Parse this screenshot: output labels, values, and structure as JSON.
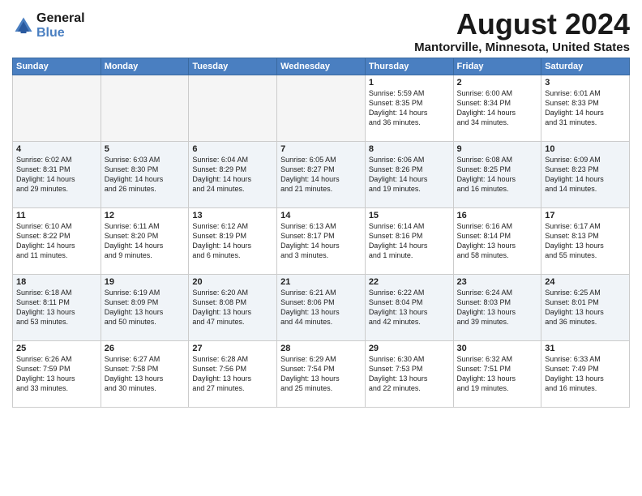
{
  "header": {
    "logo_line1": "General",
    "logo_line2": "Blue",
    "month": "August 2024",
    "location": "Mantorville, Minnesota, United States"
  },
  "weekdays": [
    "Sunday",
    "Monday",
    "Tuesday",
    "Wednesday",
    "Thursday",
    "Friday",
    "Saturday"
  ],
  "weeks": [
    [
      {
        "day": "",
        "info": ""
      },
      {
        "day": "",
        "info": ""
      },
      {
        "day": "",
        "info": ""
      },
      {
        "day": "",
        "info": ""
      },
      {
        "day": "1",
        "info": "Sunrise: 5:59 AM\nSunset: 8:35 PM\nDaylight: 14 hours\nand 36 minutes."
      },
      {
        "day": "2",
        "info": "Sunrise: 6:00 AM\nSunset: 8:34 PM\nDaylight: 14 hours\nand 34 minutes."
      },
      {
        "day": "3",
        "info": "Sunrise: 6:01 AM\nSunset: 8:33 PM\nDaylight: 14 hours\nand 31 minutes."
      }
    ],
    [
      {
        "day": "4",
        "info": "Sunrise: 6:02 AM\nSunset: 8:31 PM\nDaylight: 14 hours\nand 29 minutes."
      },
      {
        "day": "5",
        "info": "Sunrise: 6:03 AM\nSunset: 8:30 PM\nDaylight: 14 hours\nand 26 minutes."
      },
      {
        "day": "6",
        "info": "Sunrise: 6:04 AM\nSunset: 8:29 PM\nDaylight: 14 hours\nand 24 minutes."
      },
      {
        "day": "7",
        "info": "Sunrise: 6:05 AM\nSunset: 8:27 PM\nDaylight: 14 hours\nand 21 minutes."
      },
      {
        "day": "8",
        "info": "Sunrise: 6:06 AM\nSunset: 8:26 PM\nDaylight: 14 hours\nand 19 minutes."
      },
      {
        "day": "9",
        "info": "Sunrise: 6:08 AM\nSunset: 8:25 PM\nDaylight: 14 hours\nand 16 minutes."
      },
      {
        "day": "10",
        "info": "Sunrise: 6:09 AM\nSunset: 8:23 PM\nDaylight: 14 hours\nand 14 minutes."
      }
    ],
    [
      {
        "day": "11",
        "info": "Sunrise: 6:10 AM\nSunset: 8:22 PM\nDaylight: 14 hours\nand 11 minutes."
      },
      {
        "day": "12",
        "info": "Sunrise: 6:11 AM\nSunset: 8:20 PM\nDaylight: 14 hours\nand 9 minutes."
      },
      {
        "day": "13",
        "info": "Sunrise: 6:12 AM\nSunset: 8:19 PM\nDaylight: 14 hours\nand 6 minutes."
      },
      {
        "day": "14",
        "info": "Sunrise: 6:13 AM\nSunset: 8:17 PM\nDaylight: 14 hours\nand 3 minutes."
      },
      {
        "day": "15",
        "info": "Sunrise: 6:14 AM\nSunset: 8:16 PM\nDaylight: 14 hours\nand 1 minute."
      },
      {
        "day": "16",
        "info": "Sunrise: 6:16 AM\nSunset: 8:14 PM\nDaylight: 13 hours\nand 58 minutes."
      },
      {
        "day": "17",
        "info": "Sunrise: 6:17 AM\nSunset: 8:13 PM\nDaylight: 13 hours\nand 55 minutes."
      }
    ],
    [
      {
        "day": "18",
        "info": "Sunrise: 6:18 AM\nSunset: 8:11 PM\nDaylight: 13 hours\nand 53 minutes."
      },
      {
        "day": "19",
        "info": "Sunrise: 6:19 AM\nSunset: 8:09 PM\nDaylight: 13 hours\nand 50 minutes."
      },
      {
        "day": "20",
        "info": "Sunrise: 6:20 AM\nSunset: 8:08 PM\nDaylight: 13 hours\nand 47 minutes."
      },
      {
        "day": "21",
        "info": "Sunrise: 6:21 AM\nSunset: 8:06 PM\nDaylight: 13 hours\nand 44 minutes."
      },
      {
        "day": "22",
        "info": "Sunrise: 6:22 AM\nSunset: 8:04 PM\nDaylight: 13 hours\nand 42 minutes."
      },
      {
        "day": "23",
        "info": "Sunrise: 6:24 AM\nSunset: 8:03 PM\nDaylight: 13 hours\nand 39 minutes."
      },
      {
        "day": "24",
        "info": "Sunrise: 6:25 AM\nSunset: 8:01 PM\nDaylight: 13 hours\nand 36 minutes."
      }
    ],
    [
      {
        "day": "25",
        "info": "Sunrise: 6:26 AM\nSunset: 7:59 PM\nDaylight: 13 hours\nand 33 minutes."
      },
      {
        "day": "26",
        "info": "Sunrise: 6:27 AM\nSunset: 7:58 PM\nDaylight: 13 hours\nand 30 minutes."
      },
      {
        "day": "27",
        "info": "Sunrise: 6:28 AM\nSunset: 7:56 PM\nDaylight: 13 hours\nand 27 minutes."
      },
      {
        "day": "28",
        "info": "Sunrise: 6:29 AM\nSunset: 7:54 PM\nDaylight: 13 hours\nand 25 minutes."
      },
      {
        "day": "29",
        "info": "Sunrise: 6:30 AM\nSunset: 7:53 PM\nDaylight: 13 hours\nand 22 minutes."
      },
      {
        "day": "30",
        "info": "Sunrise: 6:32 AM\nSunset: 7:51 PM\nDaylight: 13 hours\nand 19 minutes."
      },
      {
        "day": "31",
        "info": "Sunrise: 6:33 AM\nSunset: 7:49 PM\nDaylight: 13 hours\nand 16 minutes."
      }
    ]
  ]
}
